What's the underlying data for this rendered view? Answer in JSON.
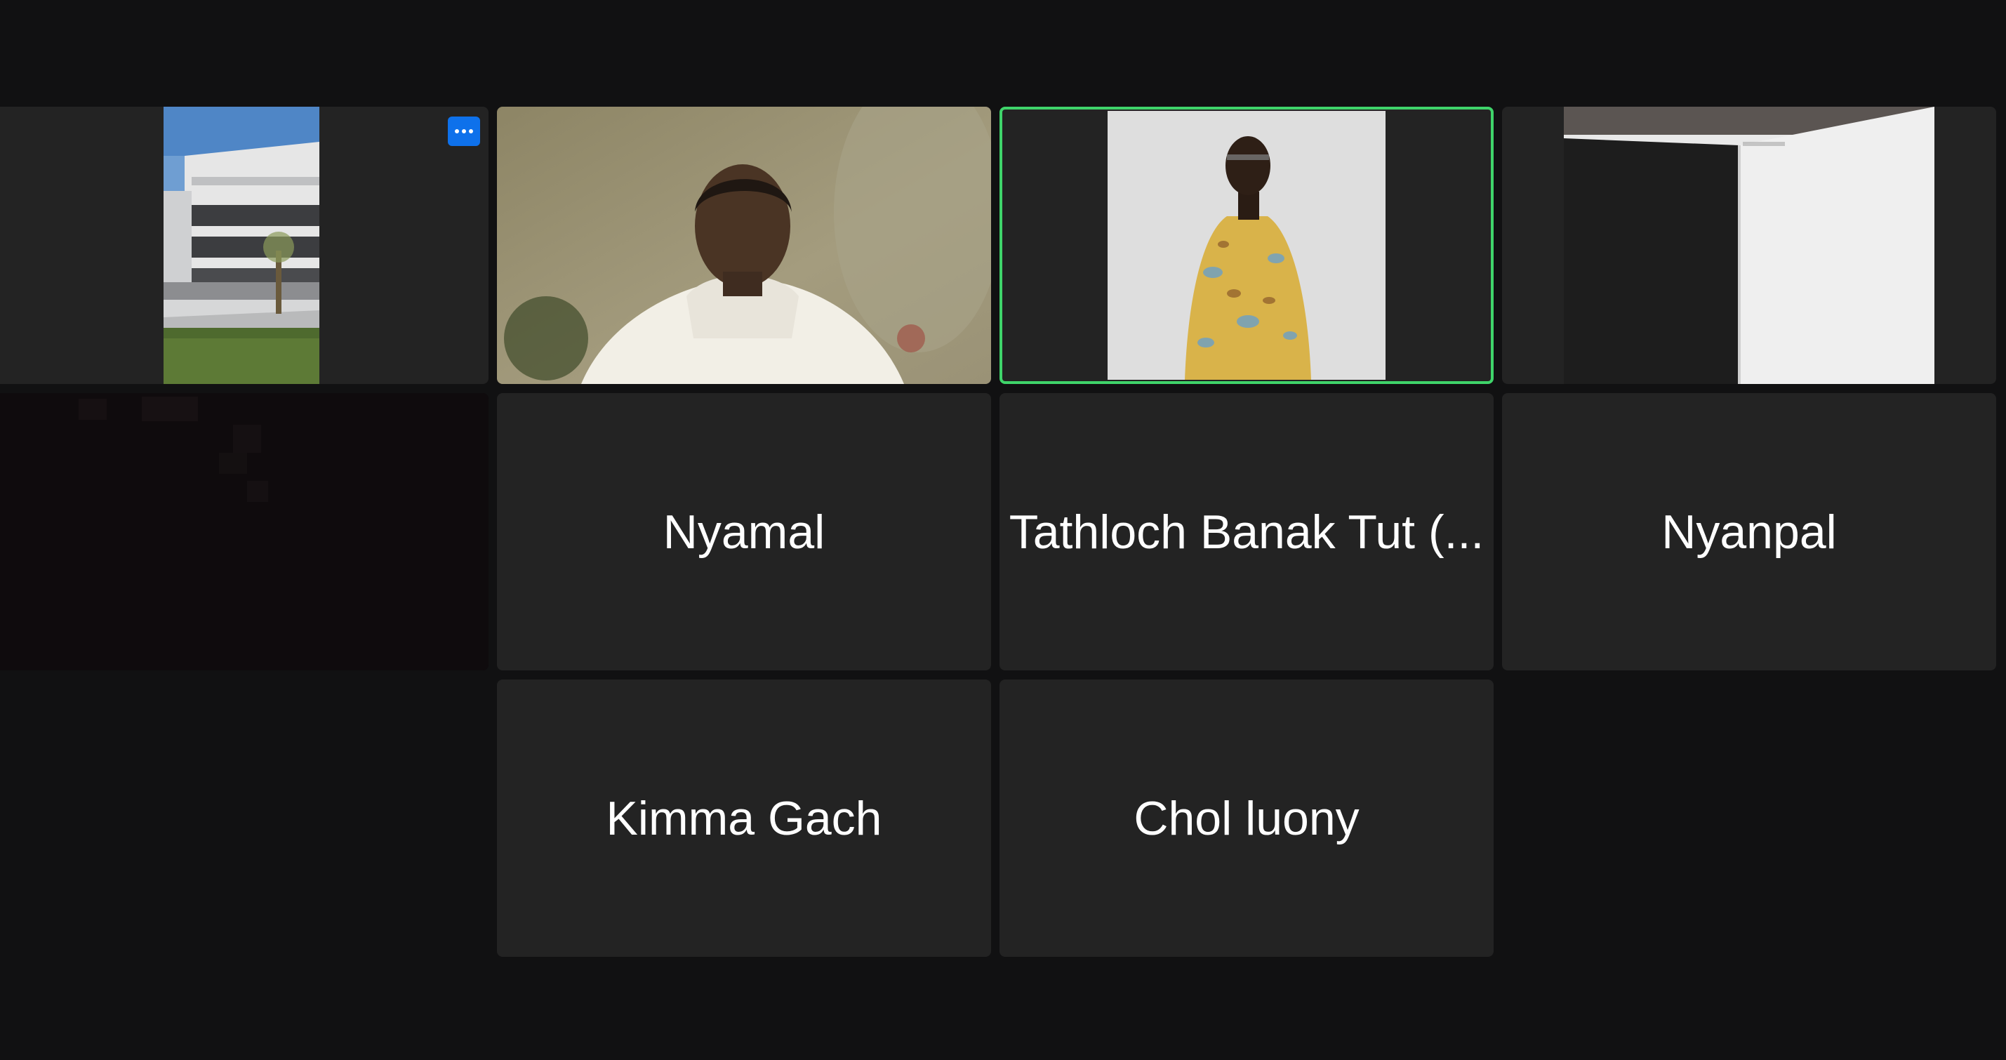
{
  "meeting": {
    "view": "gallery",
    "colors": {
      "background": "#111112",
      "tile": "#232323",
      "active_speaker_border": "#3fd46a",
      "menu_button": "#0e71eb"
    }
  },
  "participants": [
    {
      "id": "p1",
      "video_on": true,
      "video_content": "building-photo",
      "show_menu_button": true,
      "menu_icon": "ellipsis-icon"
    },
    {
      "id": "p2",
      "video_on": true,
      "video_content": "person-hoodie-webcam"
    },
    {
      "id": "p3",
      "video_on": true,
      "video_content": "person-patterned-shirt",
      "active_speaker": true
    },
    {
      "id": "p4",
      "video_on": true,
      "video_content": "open-book"
    },
    {
      "id": "p5",
      "video_on": true,
      "video_content": "dark-video"
    },
    {
      "id": "p6",
      "video_on": false,
      "name": "Nyamal"
    },
    {
      "id": "p7",
      "video_on": false,
      "name": "Tathloch Banak Tut (..."
    },
    {
      "id": "p8",
      "video_on": false,
      "name": "Nyanpal"
    },
    {
      "id": "p9",
      "video_on": false,
      "name": "Kimma Gach"
    },
    {
      "id": "p10",
      "video_on": false,
      "name": "Chol luony"
    }
  ]
}
